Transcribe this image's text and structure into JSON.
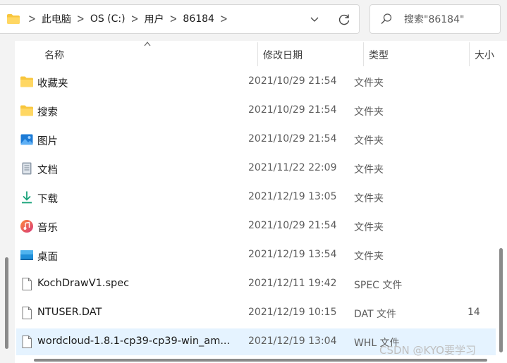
{
  "address_bar": {
    "crumbs": [
      "此电脑",
      "OS (C:)",
      "用户",
      "86184"
    ]
  },
  "search": {
    "placeholder": "搜索\"86184\""
  },
  "columns": {
    "name": "名称",
    "modified": "修改日期",
    "type": "类型",
    "size": "大小"
  },
  "files": [
    {
      "name": "收藏夹",
      "modified": "2021/10/29 21:54",
      "type": "文件夹",
      "size": "",
      "icon": "folder-icon"
    },
    {
      "name": "搜索",
      "modified": "2021/10/29 21:54",
      "type": "文件夹",
      "size": "",
      "icon": "folder-icon"
    },
    {
      "name": "图片",
      "modified": "2021/10/29 21:54",
      "type": "文件夹",
      "size": "",
      "icon": "pictures-icon"
    },
    {
      "name": "文档",
      "modified": "2021/11/22 22:09",
      "type": "文件夹",
      "size": "",
      "icon": "documents-icon"
    },
    {
      "name": "下载",
      "modified": "2021/12/19 13:05",
      "type": "文件夹",
      "size": "",
      "icon": "download-icon"
    },
    {
      "name": "音乐",
      "modified": "2021/10/29 21:54",
      "type": "文件夹",
      "size": "",
      "icon": "music-icon"
    },
    {
      "name": "桌面",
      "modified": "2021/12/19 13:54",
      "type": "文件夹",
      "size": "",
      "icon": "desktop-icon"
    },
    {
      "name": "KochDrawV1.spec",
      "modified": "2021/12/11 19:42",
      "type": "SPEC 文件",
      "size": "",
      "icon": "file-icon"
    },
    {
      "name": "NTUSER.DAT",
      "modified": "2021/12/19 10:15",
      "type": "DAT 文件",
      "size": "14",
      "icon": "file-icon"
    },
    {
      "name": "wordcloud-1.8.1-cp39-cp39-win_am...",
      "modified": "2021/12/19 13:04",
      "type": "WHL 文件",
      "size": "",
      "icon": "file-icon"
    }
  ],
  "selected_index": 9,
  "watermark": "CSDN @KYO要学习",
  "colors": {
    "selection": "#e5f3ff",
    "folder_yellow": "#f8c63d",
    "scroll_thumb": "#8a8a8a"
  }
}
